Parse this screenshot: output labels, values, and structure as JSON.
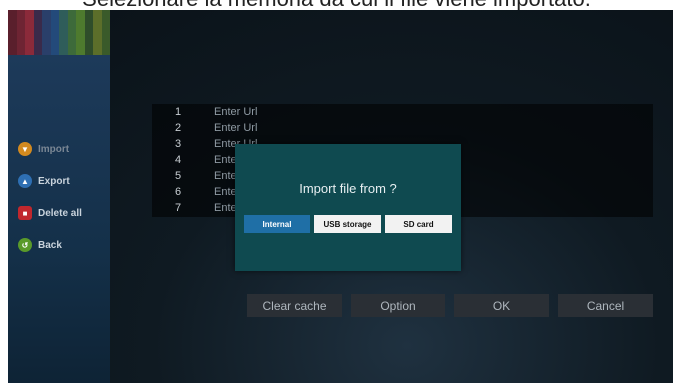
{
  "caption": "Selezionare la memoria da cui il file viene importato.",
  "sidebar": {
    "stripe_colors": [
      "#5a1f2c",
      "#6e2433",
      "#8b2a3a",
      "#3a2a4a",
      "#2a3f6a",
      "#234a7a",
      "#2f5d5a",
      "#3d6a3a",
      "#4e7a2e",
      "#2f4d2a",
      "#5c6e2a",
      "#3a5a2a"
    ],
    "items": [
      {
        "label": "Import",
        "icon": "import-icon",
        "color": "#d38a1f"
      },
      {
        "label": "Export",
        "icon": "export-icon",
        "color": "#2e6fb3"
      },
      {
        "label": "Delete all",
        "icon": "trash-icon",
        "color": "#c1272d"
      },
      {
        "label": "Back",
        "icon": "back-icon",
        "color": "#5a9a2a"
      }
    ]
  },
  "url_list": {
    "rows": [
      {
        "num": "1",
        "text": "Enter Url"
      },
      {
        "num": "2",
        "text": "Enter Url"
      },
      {
        "num": "3",
        "text": "Enter Url"
      },
      {
        "num": "4",
        "text": "Ente"
      },
      {
        "num": "5",
        "text": "Ente"
      },
      {
        "num": "6",
        "text": "Ente"
      },
      {
        "num": "7",
        "text": "Ente"
      }
    ]
  },
  "buttons": {
    "clear_cache": "Clear cache",
    "option": "Option",
    "ok": "OK",
    "cancel": "Cancel"
  },
  "dialog": {
    "title": "Import file from ?",
    "options": [
      "Internal",
      "USB storage",
      "SD card"
    ],
    "selected": "Internal"
  },
  "colors": {
    "dialog_bg": "#0f4a50",
    "selected_option": "#1f6fa6"
  }
}
